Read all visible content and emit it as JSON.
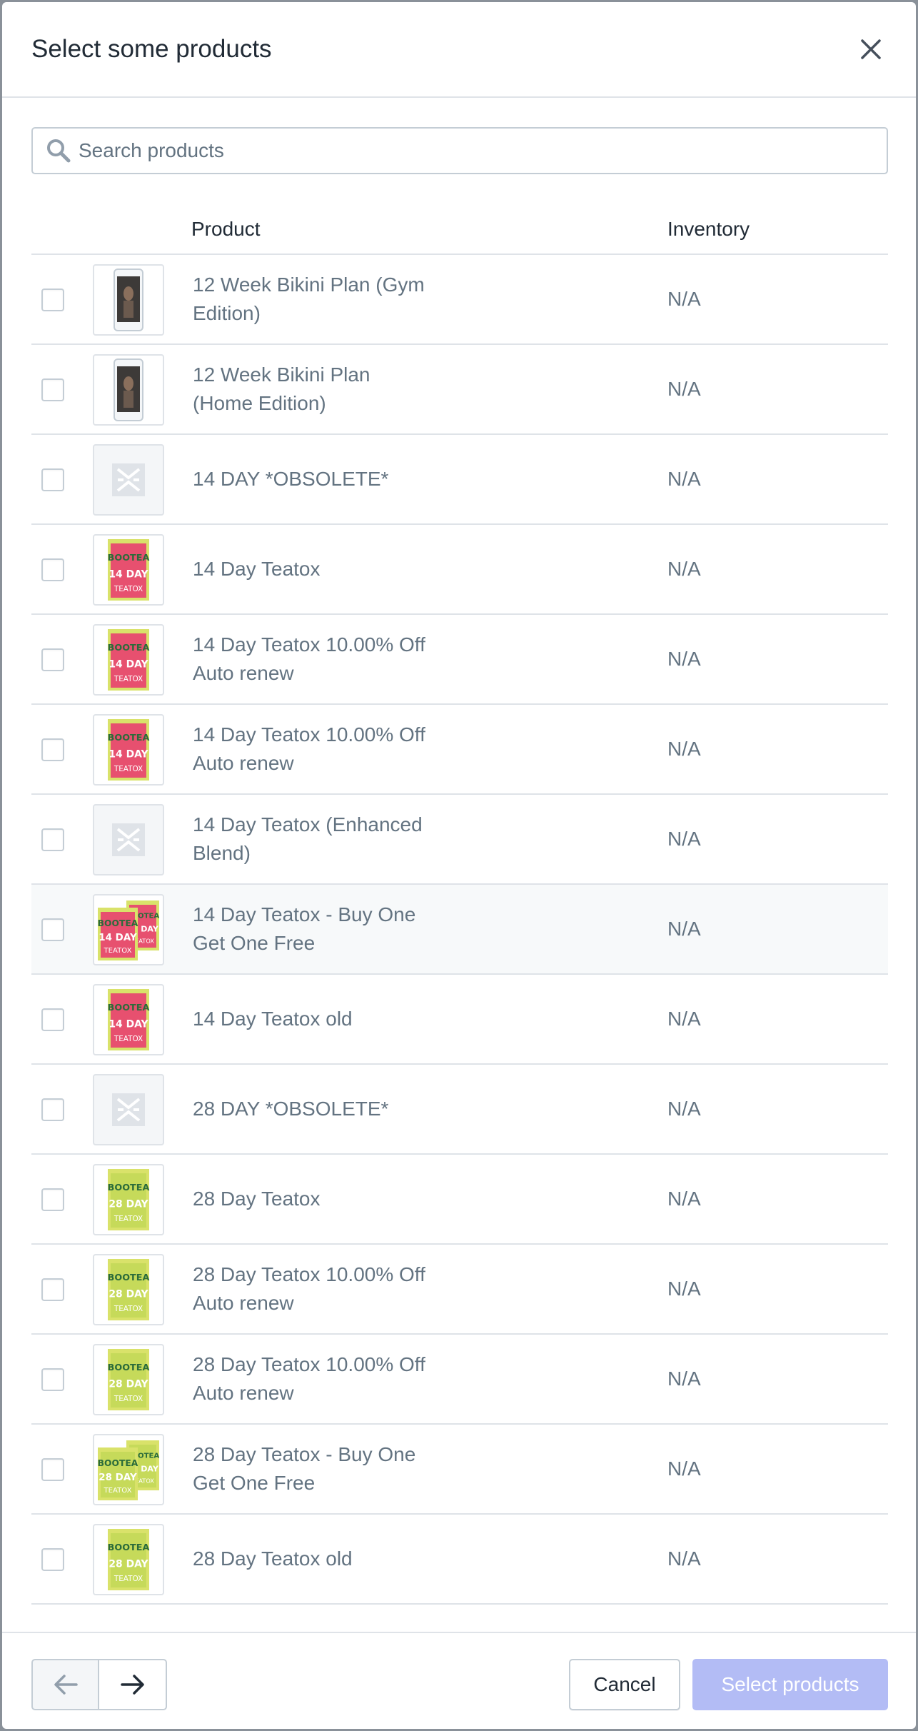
{
  "modal": {
    "title": "Select some products"
  },
  "search": {
    "placeholder": "Search products",
    "value": ""
  },
  "table": {
    "headers": {
      "product": "Product",
      "inventory": "Inventory"
    },
    "rows": [
      {
        "name": "12 Week Bikini Plan (Gym Edition)",
        "inventory": "N/A",
        "thumb": "phone-dark"
      },
      {
        "name": "12 Week Bikini Plan (Home Edition)",
        "inventory": "N/A",
        "thumb": "phone-dark"
      },
      {
        "name": "14 DAY *OBSOLETE*",
        "inventory": "N/A",
        "thumb": "placeholder"
      },
      {
        "name": "14 Day Teatox",
        "inventory": "N/A",
        "thumb": "tea-14"
      },
      {
        "name": "14 Day Teatox 10.00% Off Auto renew",
        "inventory": "N/A",
        "thumb": "tea-14"
      },
      {
        "name": "14 Day Teatox 10.00% Off Auto renew",
        "inventory": "N/A",
        "thumb": "tea-14"
      },
      {
        "name": "14 Day Teatox (Enhanced Blend)",
        "inventory": "N/A",
        "thumb": "placeholder"
      },
      {
        "name": "14 Day Teatox - Buy One Get One Free",
        "inventory": "N/A",
        "thumb": "tea-14-double"
      },
      {
        "name": "14 Day Teatox old",
        "inventory": "N/A",
        "thumb": "tea-14"
      },
      {
        "name": "28 DAY *OBSOLETE*",
        "inventory": "N/A",
        "thumb": "placeholder"
      },
      {
        "name": "28 Day Teatox",
        "inventory": "N/A",
        "thumb": "tea-28"
      },
      {
        "name": "28 Day Teatox 10.00% Off Auto renew",
        "inventory": "N/A",
        "thumb": "tea-28"
      },
      {
        "name": "28 Day Teatox 10.00% Off Auto renew",
        "inventory": "N/A",
        "thumb": "tea-28"
      },
      {
        "name": "28 Day Teatox - Buy One Get One Free",
        "inventory": "N/A",
        "thumb": "tea-28-double"
      },
      {
        "name": "28 Day Teatox old",
        "inventory": "N/A",
        "thumb": "tea-28"
      }
    ]
  },
  "footer": {
    "cancel_label": "Cancel",
    "primary_label": "Select products"
  },
  "colors": {
    "text": "#212b36",
    "subdued": "#637381",
    "border": "#dfe3e8",
    "primary_disabled": "#b3bcf5"
  }
}
